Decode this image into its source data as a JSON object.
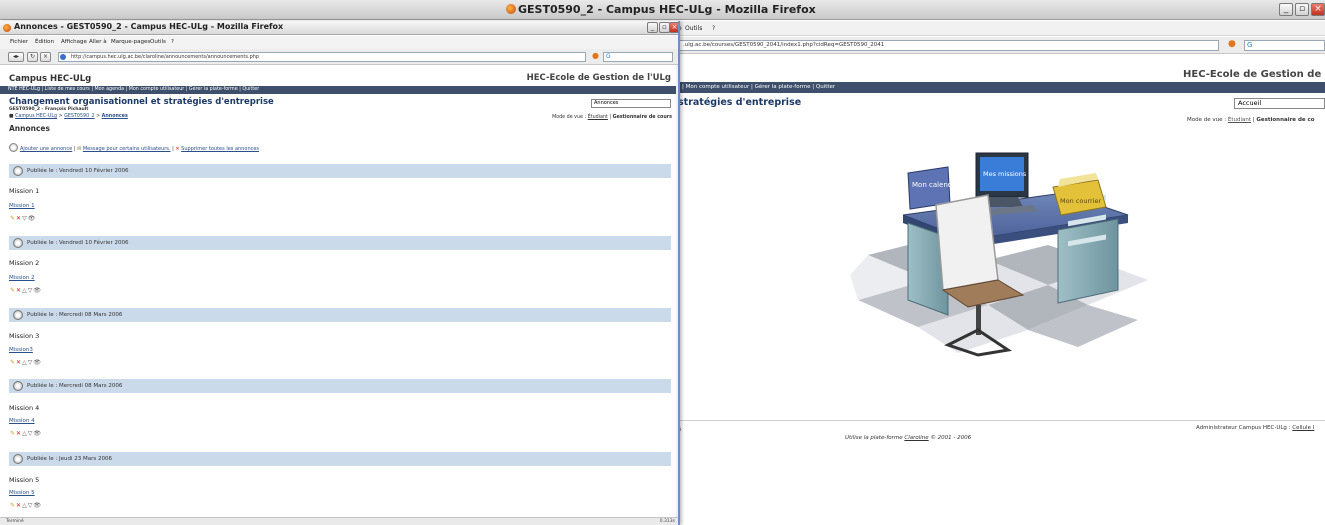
{
  "back_window": {
    "title": "GEST0590_2 - Campus HEC-ULg - Mozilla Firefox",
    "menu": [
      "e",
      "Outils",
      "?"
    ],
    "url": ".ulg.ac.be/courses/GEST0590_2041/index1.php?cidReq=GEST0590_2041",
    "site_title": "HEC-Ecole de Gestion de l'UL",
    "user_bar": "| Mon compte utilisateur | Gérer la plate-forme | Quitter",
    "course_title": "stratégies d'entreprise",
    "select_value": "Accueil",
    "mode_label": "Mode de vue :",
    "mode_student": "Étudiant",
    "mode_sep": "|",
    "mode_manager": "Gestionnaire de co",
    "desk_labels": [
      "Mon calendrier",
      "Mes missions",
      "Mon courrier"
    ],
    "footer_left": "é",
    "footer_admin": "Administrateur Campus HEC-ULg :",
    "footer_admin_link": "Cellule I",
    "footer_platform": "Utilise la plate-forme",
    "footer_platform_link": "Claroline",
    "footer_platform_years": "© 2001 - 2006"
  },
  "front_window": {
    "title": "Annonces - GEST0590_2 - Campus HEC-ULg - Mozilla Firefox",
    "menu": [
      "Fichier",
      "Édition",
      "Affichage",
      "Aller à",
      "Marque-pages",
      "Outils",
      "?"
    ],
    "url": "http://campus.hec.ulg.ac.be/claroline/announcements/announcements.php",
    "site_name": "Campus HEC-ULg",
    "site_org": "HEC-Ecole de Gestion de l'ULg",
    "user_bar": "NTE HEC-ULg | Liste de mes cours | Mon agenda | Mon compte utilisateur | Gérer la plate-forme | Quitter",
    "course_title": "Changement organisationnel et stratégies d'entreprise",
    "course_code": "GEST0590_2 - François Pichault",
    "course_select": "Annonces",
    "breadcrumb": {
      "root": "Campus HEC-ULg",
      "sep": ">",
      "course": "GEST0590_2",
      "current": "Annonces"
    },
    "mode_label": "Mode de vue :",
    "mode_student": "Étudiant",
    "mode_sep": "|",
    "mode_manager": "Gestionnaire de cours",
    "heading": "Annonces",
    "actions": {
      "add": "Ajouter une annonce",
      "sep": "|",
      "message": "Message pour certains utilisateurs.",
      "delete_all": "Supprimer toutes les annonces"
    },
    "announcements": [
      {
        "published": "Publiée le : Vendredi 10 Février 2006",
        "title": "Mission 1",
        "link": "Mission 1"
      },
      {
        "published": "Publiée le : Vendredi 10 Février 2006",
        "title": "Mission 2",
        "link": "Mission 2"
      },
      {
        "published": "Publiée le : Mercredi 08 Mars 2006",
        "title": "Mission 3",
        "link": "Mission3"
      },
      {
        "published": "Publiée le : Mercredi 08 Mars 2006",
        "title": "Mission 4",
        "link": "Mission 4"
      },
      {
        "published": "Publiée le : Jeudi 23 Mars 2006",
        "title": "Mission 5",
        "link": "Mission 5"
      }
    ],
    "status": "Terminé",
    "status_right": "0.313s"
  },
  "colors": {
    "nav_bar": "#3d4f6b",
    "announcement_header": "#cbdaea",
    "link": "#2a4f8a",
    "course_title": "#1d3a66"
  }
}
